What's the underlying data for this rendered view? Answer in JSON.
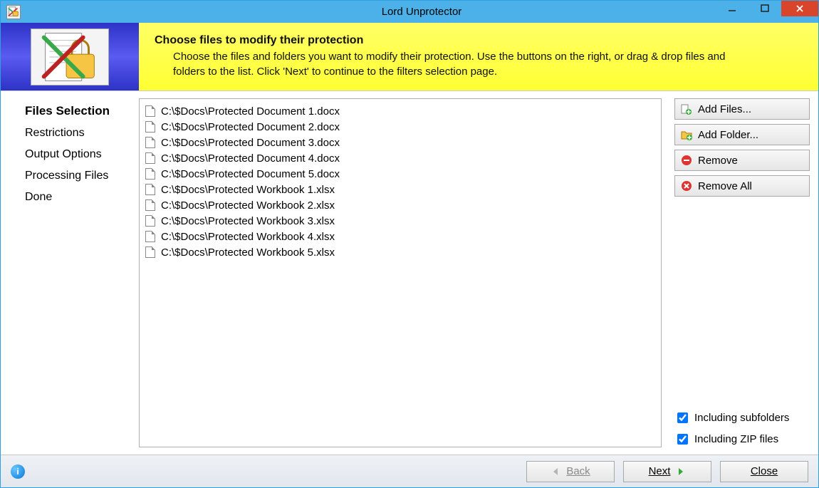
{
  "window": {
    "title": "Lord Unprotector"
  },
  "header": {
    "title": "Choose files to modify their protection",
    "description": "Choose the files and folders you want to modify their protection. Use the buttons on the right, or drag & drop files and folders to the list. Click 'Next' to continue to the filters selection page."
  },
  "sidebar": {
    "steps": [
      {
        "label": "Files Selection",
        "current": true
      },
      {
        "label": "Restrictions",
        "current": false
      },
      {
        "label": "Output Options",
        "current": false
      },
      {
        "label": "Processing Files",
        "current": false
      },
      {
        "label": "Done",
        "current": false
      }
    ]
  },
  "files": [
    "C:\\$Docs\\Protected Document 1.docx",
    "C:\\$Docs\\Protected Document 2.docx",
    "C:\\$Docs\\Protected Document 3.docx",
    "C:\\$Docs\\Protected Document 4.docx",
    "C:\\$Docs\\Protected Document 5.docx",
    "C:\\$Docs\\Protected Workbook 1.xlsx",
    "C:\\$Docs\\Protected Workbook 2.xlsx",
    "C:\\$Docs\\Protected Workbook 3.xlsx",
    "C:\\$Docs\\Protected Workbook 4.xlsx",
    "C:\\$Docs\\Protected Workbook 5.xlsx"
  ],
  "buttons": {
    "add_files": "Add Files...",
    "add_folder": "Add Folder...",
    "remove": "Remove",
    "remove_all": "Remove All"
  },
  "options": {
    "include_subfolders": {
      "label": "Including subfolders",
      "checked": true
    },
    "include_zip": {
      "label": "Including ZIP files",
      "checked": true
    }
  },
  "footer": {
    "back": "Back",
    "next": "Next",
    "close": "Close"
  }
}
